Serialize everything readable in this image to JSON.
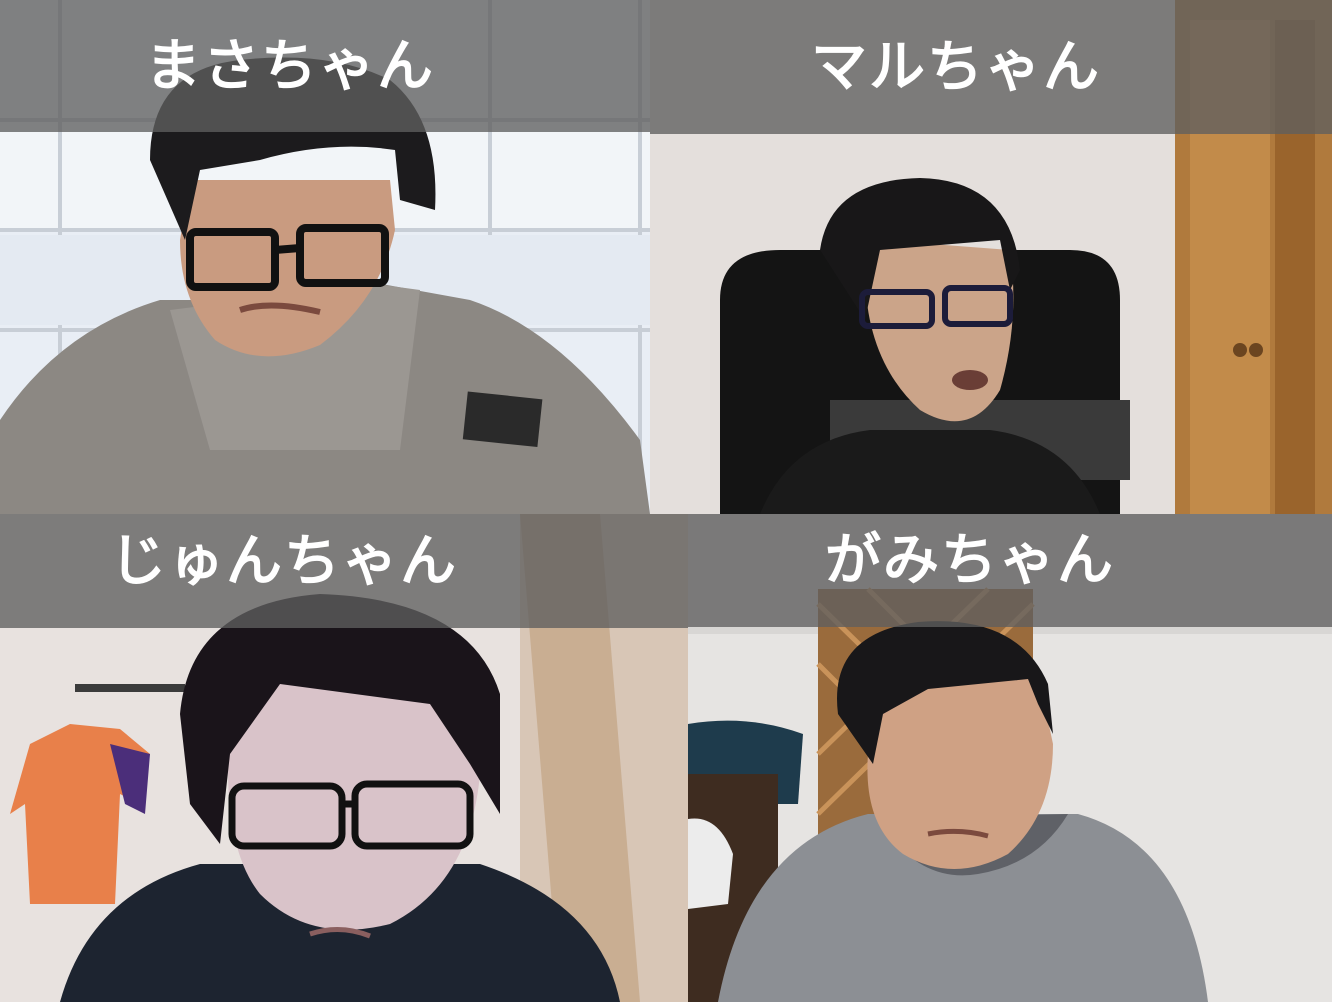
{
  "participants": [
    {
      "name": "まさちゃん"
    },
    {
      "name": "マルちゃん"
    },
    {
      "name": "じゅんちゃん"
    },
    {
      "name": "がみちゃん"
    }
  ],
  "colors": {
    "name_bar": "#5f5f5f",
    "name_text": "#ffffff"
  }
}
